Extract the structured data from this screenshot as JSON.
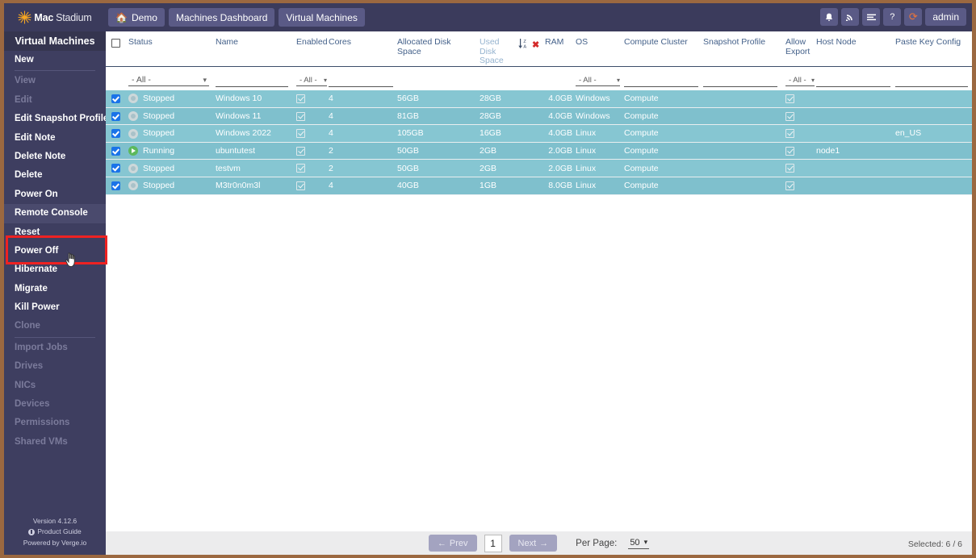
{
  "brand": {
    "mac": "Mac",
    "stadium": "Stadium",
    "icon": "sunburst-icon"
  },
  "breadcrumbs": [
    {
      "label": "Demo",
      "icon": "home-icon"
    },
    {
      "label": "Machines Dashboard",
      "icon": ""
    },
    {
      "label": "Virtual Machines",
      "icon": ""
    }
  ],
  "toolbar": {
    "bell": "▲",
    "rss": "➤",
    "list": "☰",
    "help": "?",
    "refresh": "⟳",
    "user": "admin"
  },
  "sidebar": {
    "title": "Virtual Machines",
    "items": [
      {
        "label": "New",
        "disabled": false,
        "sep_after": true
      },
      {
        "label": "View",
        "disabled": true
      },
      {
        "label": "Edit",
        "disabled": true
      },
      {
        "label": "Edit Snapshot Profile",
        "disabled": false
      },
      {
        "label": "Edit Note",
        "disabled": false
      },
      {
        "label": "Delete Note",
        "disabled": false
      },
      {
        "label": "Delete",
        "disabled": false
      },
      {
        "label": "Power On",
        "disabled": false
      },
      {
        "label": "Remote Console",
        "disabled": false,
        "highlighted": true
      },
      {
        "label": "Reset",
        "disabled": false
      },
      {
        "label": "Power Off",
        "disabled": false
      },
      {
        "label": "Hibernate",
        "disabled": false
      },
      {
        "label": "Migrate",
        "disabled": false
      },
      {
        "label": "Kill Power",
        "disabled": false
      },
      {
        "label": "Clone",
        "disabled": true,
        "sep_after": true
      },
      {
        "label": "Import Jobs",
        "disabled": true
      },
      {
        "label": "Drives",
        "disabled": true
      },
      {
        "label": "NICs",
        "disabled": true
      },
      {
        "label": "Devices",
        "disabled": true
      },
      {
        "label": "Permissions",
        "disabled": true
      },
      {
        "label": "Shared VMs",
        "disabled": true
      }
    ],
    "footer": {
      "version": "Version 4.12.6",
      "product_guide": "Product Guide",
      "powered_by": "Powered by Verge.io"
    }
  },
  "table": {
    "columns": [
      {
        "key": "select",
        "label": "",
        "muted": false
      },
      {
        "key": "status",
        "label": "Status",
        "muted": false
      },
      {
        "key": "name",
        "label": "Name",
        "muted": false
      },
      {
        "key": "enabled",
        "label": "Enabled",
        "muted": false
      },
      {
        "key": "cores",
        "label": "Cores",
        "muted": false
      },
      {
        "key": "alloc",
        "label": "Allocated Disk Space",
        "muted": false
      },
      {
        "key": "used",
        "label": "Used Disk Space",
        "muted": true
      },
      {
        "key": "sort",
        "label": "",
        "muted": false
      },
      {
        "key": "ram",
        "label": "RAM",
        "muted": false
      },
      {
        "key": "os",
        "label": "OS",
        "muted": false
      },
      {
        "key": "cluster",
        "label": "Compute Cluster",
        "muted": false
      },
      {
        "key": "snapshot",
        "label": "Snapshot Profile",
        "muted": false
      },
      {
        "key": "export",
        "label": "Allow Export",
        "muted": false
      },
      {
        "key": "host",
        "label": "Host Node",
        "muted": false
      },
      {
        "key": "paste",
        "label": "Paste Key Config",
        "muted": false
      }
    ],
    "sort": {
      "icon": "sort-descending-icon",
      "clear_icon": "clear-sort-icon",
      "clear_glyph": "✖"
    },
    "filters": {
      "status": "- All -",
      "name": "",
      "enabled": "- All -",
      "cores": "",
      "os": "- All -",
      "cluster": "",
      "snapshot": "",
      "export": "- All -",
      "host": "",
      "paste": ""
    },
    "rows": [
      {
        "selected": true,
        "status": "Stopped",
        "state": "stopped",
        "name": "Windows 10",
        "enabled": true,
        "cores": "4",
        "alloc": "56GB",
        "used": "28GB",
        "ram": "4.0GB",
        "os": "Windows",
        "cluster": "Compute",
        "snapshot": "",
        "export": true,
        "host": "",
        "paste": ""
      },
      {
        "selected": true,
        "status": "Stopped",
        "state": "stopped",
        "name": "Windows 11",
        "enabled": true,
        "cores": "4",
        "alloc": "81GB",
        "used": "28GB",
        "ram": "4.0GB",
        "os": "Windows",
        "cluster": "Compute",
        "snapshot": "",
        "export": true,
        "host": "",
        "paste": ""
      },
      {
        "selected": true,
        "status": "Stopped",
        "state": "stopped",
        "name": "Windows 2022",
        "enabled": true,
        "cores": "4",
        "alloc": "105GB",
        "used": "16GB",
        "ram": "4.0GB",
        "os": "Linux",
        "cluster": "Compute",
        "snapshot": "",
        "export": true,
        "host": "",
        "paste": "en_US"
      },
      {
        "selected": true,
        "status": "Running",
        "state": "running",
        "name": "ubuntutest",
        "enabled": true,
        "cores": "2",
        "alloc": "50GB",
        "used": "2GB",
        "ram": "2.0GB",
        "os": "Linux",
        "cluster": "Compute",
        "snapshot": "",
        "export": true,
        "host": "node1",
        "paste": ""
      },
      {
        "selected": true,
        "status": "Stopped",
        "state": "stopped",
        "name": "testvm",
        "enabled": true,
        "cores": "2",
        "alloc": "50GB",
        "used": "2GB",
        "ram": "2.0GB",
        "os": "Linux",
        "cluster": "Compute",
        "snapshot": "",
        "export": true,
        "host": "",
        "paste": ""
      },
      {
        "selected": true,
        "status": "Stopped",
        "state": "stopped",
        "name": "M3tr0n0m3l",
        "enabled": true,
        "cores": "4",
        "alloc": "40GB",
        "used": "1GB",
        "ram": "8.0GB",
        "os": "Linux",
        "cluster": "Compute",
        "snapshot": "",
        "export": true,
        "host": "",
        "paste": ""
      }
    ]
  },
  "pagination": {
    "prev": "Prev",
    "prev_icon": "←",
    "page": "1",
    "next": "Next",
    "next_icon": "→",
    "per_page_label": "Per Page:",
    "per_page_value": "50",
    "selected": "Selected: 6 / 6"
  },
  "colors": {
    "frame": "#9b6840",
    "topbar": "#3b3b5c",
    "sidebar": "#3e3e60",
    "row_odd": "#86c6d2",
    "row_even": "#7fc0cd",
    "accent_checkbox": "#1a73e8",
    "running": "#5cb85c",
    "highlight_box": "#ee2222",
    "refresh_icon": "#e8743b"
  }
}
